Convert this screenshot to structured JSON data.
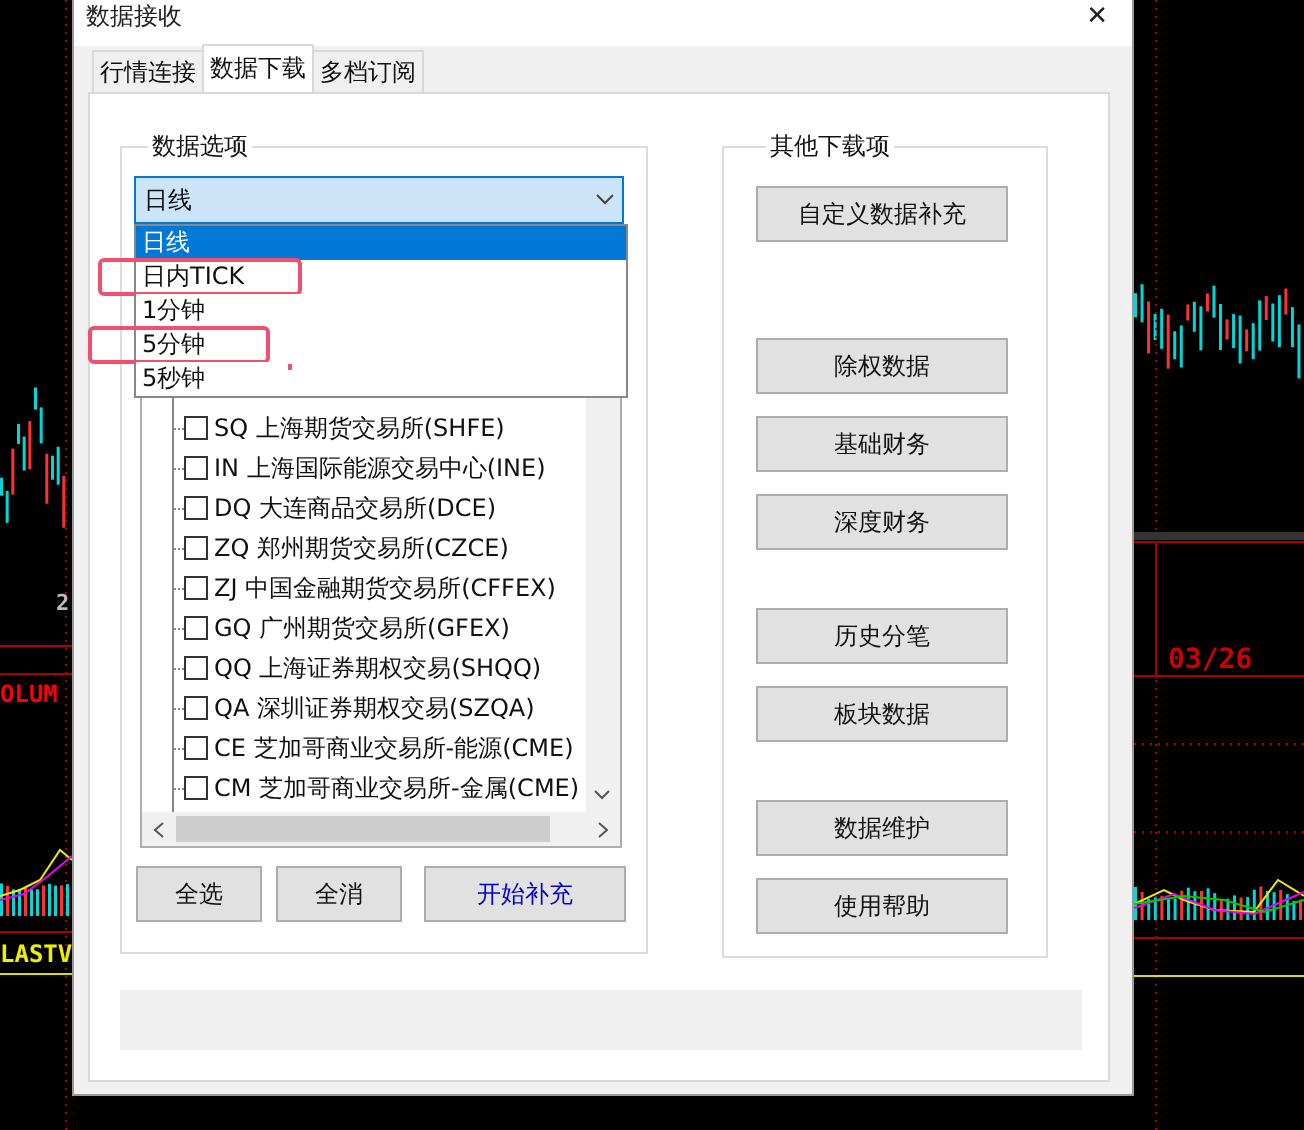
{
  "window": {
    "title": "数据接收",
    "close": "✕"
  },
  "tabs": [
    {
      "label": "行情连接",
      "selected": false
    },
    {
      "label": "数据下载",
      "selected": true
    },
    {
      "label": "多档订阅",
      "selected": false
    }
  ],
  "data_options": {
    "legend": "数据选项",
    "combo_value": "日线",
    "dropdown": [
      {
        "label": "日线",
        "selected": true,
        "highlighted": false
      },
      {
        "label": "日内TICK",
        "selected": false,
        "highlighted": true
      },
      {
        "label": "1分钟",
        "selected": false,
        "highlighted": false
      },
      {
        "label": "5分钟",
        "selected": false,
        "highlighted": true
      },
      {
        "label": "5秒钟",
        "selected": false,
        "highlighted": false
      }
    ],
    "exchanges": [
      {
        "label": "SQ 上海期货交易所(SHFE)",
        "checked": false
      },
      {
        "label": "IN 上海国际能源交易中心(INE)",
        "checked": false
      },
      {
        "label": "DQ 大连商品交易所(DCE)",
        "checked": false
      },
      {
        "label": "ZQ 郑州期货交易所(CZCE)",
        "checked": false
      },
      {
        "label": "ZJ 中国金融期货交易所(CFFEX)",
        "checked": false
      },
      {
        "label": "GQ 广州期货交易所(GFEX)",
        "checked": false
      },
      {
        "label": "QQ 上海证券期权交易(SHQQ)",
        "checked": false
      },
      {
        "label": "QA 深圳证券期权交易(SZQA)",
        "checked": false
      },
      {
        "label": "CE 芝加哥商业交易所-能源(CME)",
        "checked": false
      },
      {
        "label": "CM 芝加哥商业交易所-金属(CME)",
        "checked": false
      }
    ],
    "buttons": [
      {
        "label": "全选",
        "kind": "plain"
      },
      {
        "label": "全消",
        "kind": "plain"
      },
      {
        "label": "开始补充",
        "kind": "primary"
      }
    ]
  },
  "other_downloads": {
    "legend": "其他下载项",
    "buttons": [
      "自定义数据补充",
      "除权数据",
      "基础财务",
      "深度财务",
      "历史分笔",
      "板块数据",
      "数据维护",
      "使用帮助"
    ]
  },
  "chart_labels": {
    "left_volume": "OLUM",
    "left_last": "LASTV",
    "left_number": "2",
    "right_date": "03/26"
  }
}
